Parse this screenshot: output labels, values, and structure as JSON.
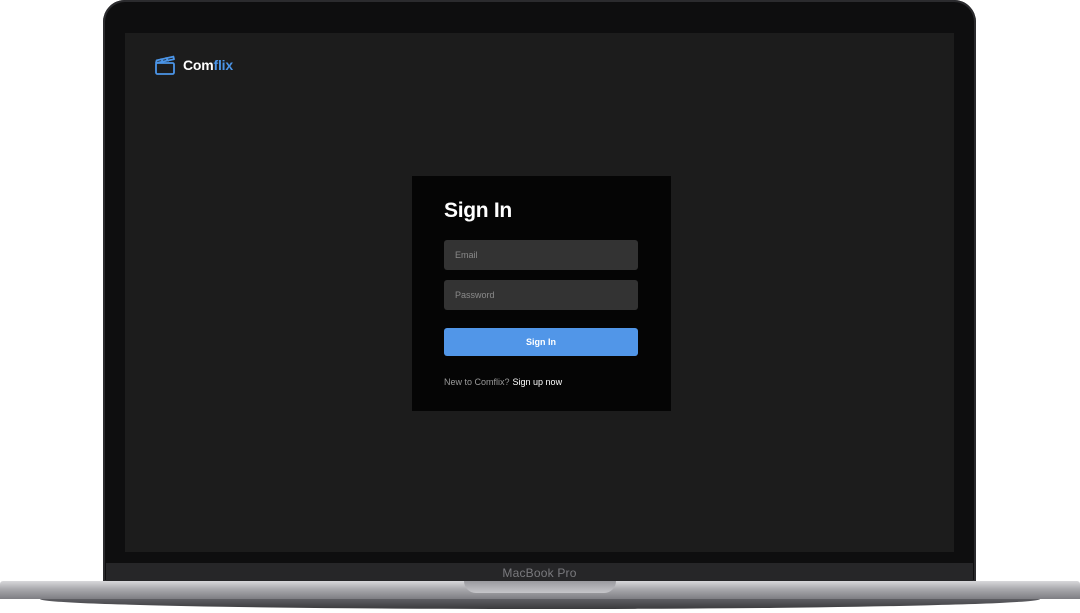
{
  "device": {
    "label": "MacBook Pro"
  },
  "brand": {
    "name_part1": "Com",
    "name_part2": "flix",
    "accent_color": "#4b95e8",
    "icon": "clapperboard-icon"
  },
  "signin": {
    "title": "Sign In",
    "email_placeholder": "Email",
    "password_placeholder": "Password",
    "submit_label": "Sign In",
    "new_user_text": "New to Comflix?",
    "signup_link": "Sign up now"
  },
  "colors": {
    "background": "#1c1c1c",
    "card": "#050505",
    "field": "#333333",
    "button": "#5196e8"
  }
}
